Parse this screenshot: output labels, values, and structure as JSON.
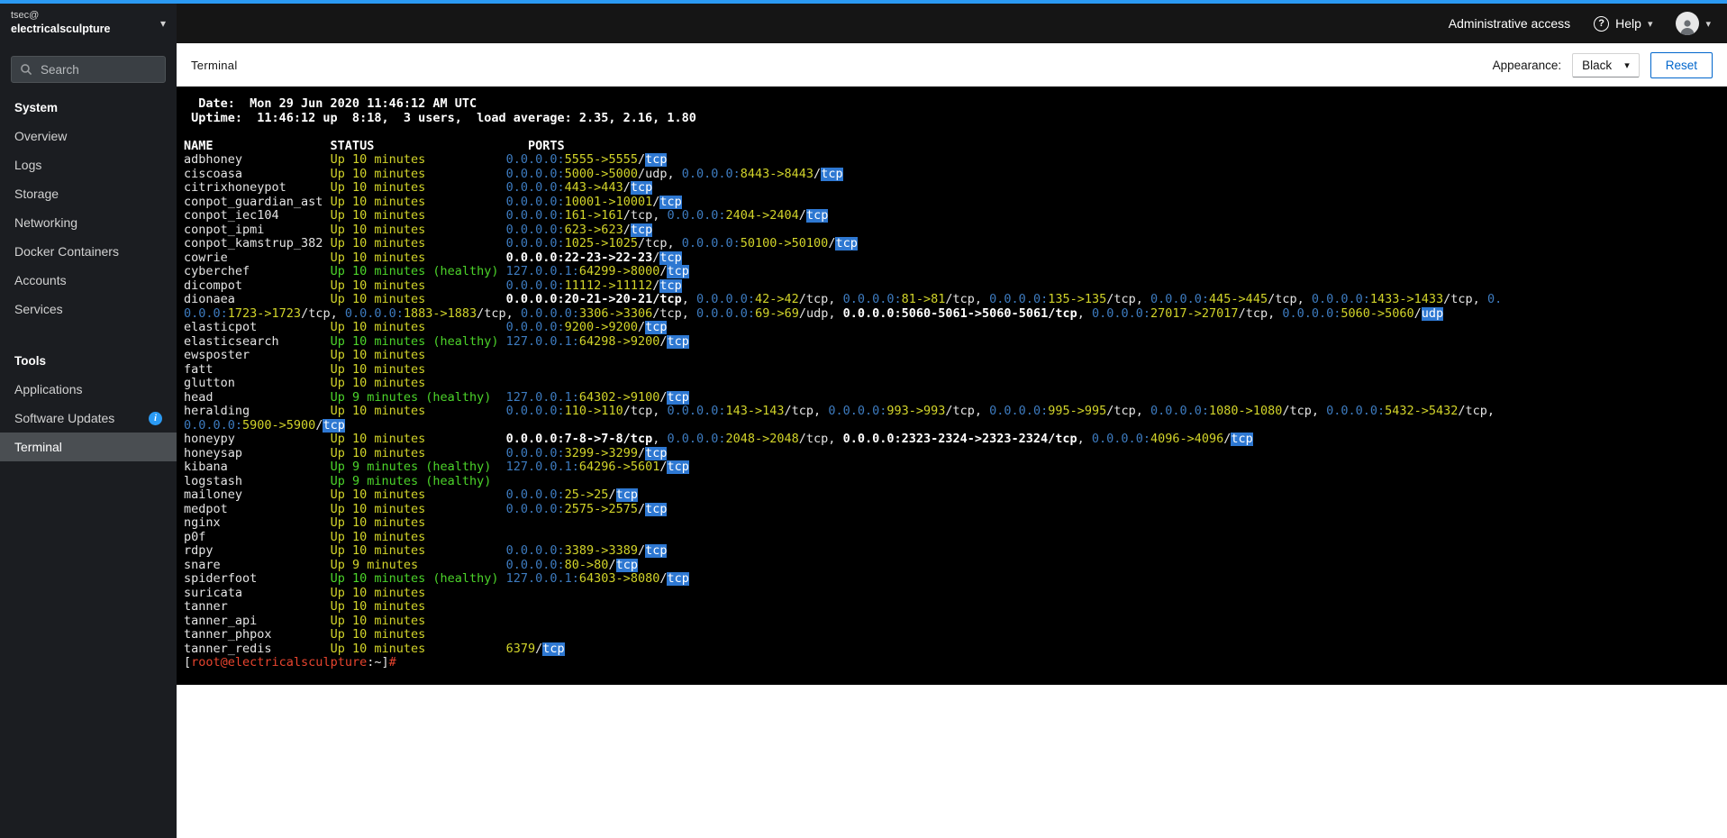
{
  "palette": {
    "accent_blue": "#2b9af3",
    "terminal_bg": "#000000",
    "term_fg": "#e4e4e4",
    "term_bold": "#ffffff",
    "term_yellow": "#d2d42a",
    "term_green": "#4cd42a",
    "term_blue": "#3d7bbf",
    "term_red": "#e8442e",
    "term_highlight_bg": "#2e78d2"
  },
  "icons": {
    "caret_down": "▾",
    "help": "?",
    "info": "i"
  },
  "masthead": {
    "host_user": "tsec@",
    "host_name": "electricalsculpture",
    "admin_access_label": "Administrative access",
    "help_label": "Help"
  },
  "sidebar": {
    "search_placeholder": "Search",
    "sections": [
      {
        "title": "System",
        "items": [
          {
            "label": "Overview"
          },
          {
            "label": "Logs"
          },
          {
            "label": "Storage"
          },
          {
            "label": "Networking"
          },
          {
            "label": "Docker Containers"
          },
          {
            "label": "Accounts"
          },
          {
            "label": "Services"
          }
        ]
      },
      {
        "title": "Tools",
        "items": [
          {
            "label": "Applications"
          },
          {
            "label": "Software Updates",
            "info": true
          },
          {
            "label": "Terminal",
            "selected": true
          }
        ]
      }
    ]
  },
  "content_header": {
    "title": "Terminal",
    "appearance_label": "Appearance:",
    "appearance_value": "Black",
    "reset_label": "Reset"
  },
  "terminal": {
    "lines": [
      [
        [
          "  Date:  Mon 29 Jun 2020 11:46:12 AM UTC",
          "b"
        ]
      ],
      [
        [
          " Uptime:  11:46:12 up  8:18,  3 users,  load average: 2.35, 2.16, 1.80",
          "b"
        ]
      ],
      [
        [
          " ",
          "w"
        ]
      ],
      [
        [
          "NAME                STATUS                     PORTS",
          "b"
        ]
      ],
      [
        [
          "adbhoney            ",
          "w"
        ],
        [
          "Up 10 minutes           ",
          "y"
        ],
        [
          "0.0.0.0:",
          "bl"
        ],
        [
          "5555->5555",
          "y"
        ],
        [
          "/",
          "w"
        ],
        [
          "tcp",
          "hl"
        ]
      ],
      [
        [
          "ciscoasa            ",
          "w"
        ],
        [
          "Up 10 minutes           ",
          "y"
        ],
        [
          "0.0.0.0:",
          "bl"
        ],
        [
          "5000->5000",
          "y"
        ],
        [
          "/udp, ",
          "w"
        ],
        [
          "0.0.0.0:",
          "bl"
        ],
        [
          "8443->8443",
          "y"
        ],
        [
          "/",
          "w"
        ],
        [
          "tcp",
          "hl"
        ]
      ],
      [
        [
          "citrixhoneypot      ",
          "w"
        ],
        [
          "Up 10 minutes           ",
          "y"
        ],
        [
          "0.0.0.0:",
          "bl"
        ],
        [
          "443->443",
          "y"
        ],
        [
          "/",
          "w"
        ],
        [
          "tcp",
          "hl"
        ]
      ],
      [
        [
          "conpot_guardian_ast ",
          "w"
        ],
        [
          "Up 10 minutes           ",
          "y"
        ],
        [
          "0.0.0.0:",
          "bl"
        ],
        [
          "10001->10001",
          "y"
        ],
        [
          "/",
          "w"
        ],
        [
          "tcp",
          "hl"
        ]
      ],
      [
        [
          "conpot_iec104       ",
          "w"
        ],
        [
          "Up 10 minutes           ",
          "y"
        ],
        [
          "0.0.0.0:",
          "bl"
        ],
        [
          "161->161",
          "y"
        ],
        [
          "/tcp, ",
          "w"
        ],
        [
          "0.0.0.0:",
          "bl"
        ],
        [
          "2404->2404",
          "y"
        ],
        [
          "/",
          "w"
        ],
        [
          "tcp",
          "hl"
        ]
      ],
      [
        [
          "conpot_ipmi         ",
          "w"
        ],
        [
          "Up 10 minutes           ",
          "y"
        ],
        [
          "0.0.0.0:",
          "bl"
        ],
        [
          "623->623",
          "y"
        ],
        [
          "/",
          "w"
        ],
        [
          "tcp",
          "hl"
        ]
      ],
      [
        [
          "conpot_kamstrup_382 ",
          "w"
        ],
        [
          "Up 10 minutes           ",
          "y"
        ],
        [
          "0.0.0.0:",
          "bl"
        ],
        [
          "1025->1025",
          "y"
        ],
        [
          "/tcp, ",
          "w"
        ],
        [
          "0.0.0.0:",
          "bl"
        ],
        [
          "50100->50100",
          "y"
        ],
        [
          "/",
          "w"
        ],
        [
          "tcp",
          "hl"
        ]
      ],
      [
        [
          "cowrie              ",
          "w"
        ],
        [
          "Up 10 minutes           ",
          "y"
        ],
        [
          "0.0.0.0:22-23->22-23",
          "b"
        ],
        [
          "/",
          "w"
        ],
        [
          "tcp",
          "hl"
        ]
      ],
      [
        [
          "cyberchef           ",
          "w"
        ],
        [
          "Up 10 minutes (healthy) ",
          "g"
        ],
        [
          "127.0.0.1:",
          "bl"
        ],
        [
          "64299->8000",
          "y"
        ],
        [
          "/",
          "w"
        ],
        [
          "tcp",
          "hl"
        ]
      ],
      [
        [
          "dicompot            ",
          "w"
        ],
        [
          "Up 10 minutes           ",
          "y"
        ],
        [
          "0.0.0.0:",
          "bl"
        ],
        [
          "11112->11112",
          "y"
        ],
        [
          "/",
          "w"
        ],
        [
          "tcp",
          "hl"
        ]
      ],
      [
        [
          "dionaea             ",
          "w"
        ],
        [
          "Up 10 minutes           ",
          "y"
        ],
        [
          "0.0.0.0:20-21->20-21/tcp",
          "b"
        ],
        [
          ", ",
          "w"
        ],
        [
          "0.0.0.0:",
          "bl"
        ],
        [
          "42->42",
          "y"
        ],
        [
          "/tcp, ",
          "w"
        ],
        [
          "0.0.0.0:",
          "bl"
        ],
        [
          "81->81",
          "y"
        ],
        [
          "/tcp, ",
          "w"
        ],
        [
          "0.0.0.0:",
          "bl"
        ],
        [
          "135->135",
          "y"
        ],
        [
          "/tcp, ",
          "w"
        ],
        [
          "0.0.0.0:",
          "bl"
        ],
        [
          "445->445",
          "y"
        ],
        [
          "/tcp, ",
          "w"
        ],
        [
          "0.0.0.0:",
          "bl"
        ],
        [
          "1433->1433",
          "y"
        ],
        [
          "/tcp, ",
          "w"
        ],
        [
          "0.",
          "bl"
        ]
      ],
      [
        [
          "0.0.0:",
          "bl"
        ],
        [
          "1723->1723",
          "y"
        ],
        [
          "/tcp, ",
          "w"
        ],
        [
          "0.0.0.0:",
          "bl"
        ],
        [
          "1883->1883",
          "y"
        ],
        [
          "/tcp, ",
          "w"
        ],
        [
          "0.0.0.0:",
          "bl"
        ],
        [
          "3306->3306",
          "y"
        ],
        [
          "/tcp, ",
          "w"
        ],
        [
          "0.0.0.0:",
          "bl"
        ],
        [
          "69->69",
          "y"
        ],
        [
          "/udp, ",
          "w"
        ],
        [
          "0.0.0.0:5060-5061->5060-5061/tcp",
          "b"
        ],
        [
          ", ",
          "w"
        ],
        [
          "0.0.0.0:",
          "bl"
        ],
        [
          "27017->27017",
          "y"
        ],
        [
          "/tcp, ",
          "w"
        ],
        [
          "0.0.0.0:",
          "bl"
        ],
        [
          "5060->5060",
          "y"
        ],
        [
          "/",
          "w"
        ],
        [
          "udp",
          "hl"
        ]
      ],
      [
        [
          "elasticpot          ",
          "w"
        ],
        [
          "Up 10 minutes           ",
          "y"
        ],
        [
          "0.0.0.0:",
          "bl"
        ],
        [
          "9200->9200",
          "y"
        ],
        [
          "/",
          "w"
        ],
        [
          "tcp",
          "hl"
        ]
      ],
      [
        [
          "elasticsearch       ",
          "w"
        ],
        [
          "Up 10 minutes (healthy) ",
          "g"
        ],
        [
          "127.0.0.1:",
          "bl"
        ],
        [
          "64298->9200",
          "y"
        ],
        [
          "/",
          "w"
        ],
        [
          "tcp",
          "hl"
        ]
      ],
      [
        [
          "ewsposter           ",
          "w"
        ],
        [
          "Up 10 minutes",
          "y"
        ]
      ],
      [
        [
          "fatt                ",
          "w"
        ],
        [
          "Up 10 minutes",
          "y"
        ]
      ],
      [
        [
          "glutton             ",
          "w"
        ],
        [
          "Up 10 minutes",
          "y"
        ]
      ],
      [
        [
          "head                ",
          "w"
        ],
        [
          "Up 9 minutes (healthy)  ",
          "g"
        ],
        [
          "127.0.0.1:",
          "bl"
        ],
        [
          "64302->9100",
          "y"
        ],
        [
          "/",
          "w"
        ],
        [
          "tcp",
          "hl"
        ]
      ],
      [
        [
          "heralding           ",
          "w"
        ],
        [
          "Up 10 minutes           ",
          "y"
        ],
        [
          "0.0.0.0:",
          "bl"
        ],
        [
          "110->110",
          "y"
        ],
        [
          "/tcp, ",
          "w"
        ],
        [
          "0.0.0.0:",
          "bl"
        ],
        [
          "143->143",
          "y"
        ],
        [
          "/tcp, ",
          "w"
        ],
        [
          "0.0.0.0:",
          "bl"
        ],
        [
          "993->993",
          "y"
        ],
        [
          "/tcp, ",
          "w"
        ],
        [
          "0.0.0.0:",
          "bl"
        ],
        [
          "995->995",
          "y"
        ],
        [
          "/tcp, ",
          "w"
        ],
        [
          "0.0.0.0:",
          "bl"
        ],
        [
          "1080->1080",
          "y"
        ],
        [
          "/tcp, ",
          "w"
        ],
        [
          "0.0.0.0:",
          "bl"
        ],
        [
          "5432->5432",
          "y"
        ],
        [
          "/tcp,",
          "w"
        ]
      ],
      [
        [
          "0.0.0.0:",
          "bl"
        ],
        [
          "5900->5900",
          "y"
        ],
        [
          "/",
          "w"
        ],
        [
          "tcp",
          "hl"
        ]
      ],
      [
        [
          "honeypy             ",
          "w"
        ],
        [
          "Up 10 minutes           ",
          "y"
        ],
        [
          "0.0.0.0:7-8->7-8/tcp",
          "b"
        ],
        [
          ", ",
          "w"
        ],
        [
          "0.0.0.0:",
          "bl"
        ],
        [
          "2048->2048",
          "y"
        ],
        [
          "/tcp, ",
          "w"
        ],
        [
          "0.0.0.0:2323-2324->2323-2324/tcp",
          "b"
        ],
        [
          ", ",
          "w"
        ],
        [
          "0.0.0.0:",
          "bl"
        ],
        [
          "4096->4096",
          "y"
        ],
        [
          "/",
          "w"
        ],
        [
          "tcp",
          "hl"
        ]
      ],
      [
        [
          "honeysap            ",
          "w"
        ],
        [
          "Up 10 minutes           ",
          "y"
        ],
        [
          "0.0.0.0:",
          "bl"
        ],
        [
          "3299->3299",
          "y"
        ],
        [
          "/",
          "w"
        ],
        [
          "tcp",
          "hl"
        ]
      ],
      [
        [
          "kibana              ",
          "w"
        ],
        [
          "Up 9 minutes (healthy)  ",
          "g"
        ],
        [
          "127.0.0.1:",
          "bl"
        ],
        [
          "64296->5601",
          "y"
        ],
        [
          "/",
          "w"
        ],
        [
          "tcp",
          "hl"
        ]
      ],
      [
        [
          "logstash            ",
          "w"
        ],
        [
          "Up 9 minutes (healthy)",
          "g"
        ]
      ],
      [
        [
          "mailoney            ",
          "w"
        ],
        [
          "Up 10 minutes           ",
          "y"
        ],
        [
          "0.0.0.0:",
          "bl"
        ],
        [
          "25->25",
          "y"
        ],
        [
          "/",
          "w"
        ],
        [
          "tcp",
          "hl"
        ]
      ],
      [
        [
          "medpot              ",
          "w"
        ],
        [
          "Up 10 minutes           ",
          "y"
        ],
        [
          "0.0.0.0:",
          "bl"
        ],
        [
          "2575->2575",
          "y"
        ],
        [
          "/",
          "w"
        ],
        [
          "tcp",
          "hl"
        ]
      ],
      [
        [
          "nginx               ",
          "w"
        ],
        [
          "Up 10 minutes",
          "y"
        ]
      ],
      [
        [
          "p0f                 ",
          "w"
        ],
        [
          "Up 10 minutes",
          "y"
        ]
      ],
      [
        [
          "rdpy                ",
          "w"
        ],
        [
          "Up 10 minutes           ",
          "y"
        ],
        [
          "0.0.0.0:",
          "bl"
        ],
        [
          "3389->3389",
          "y"
        ],
        [
          "/",
          "w"
        ],
        [
          "tcp",
          "hl"
        ]
      ],
      [
        [
          "snare               ",
          "w"
        ],
        [
          "Up 9 minutes            ",
          "y"
        ],
        [
          "0.0.0.0:",
          "bl"
        ],
        [
          "80->80",
          "y"
        ],
        [
          "/",
          "w"
        ],
        [
          "tcp",
          "hl"
        ]
      ],
      [
        [
          "spiderfoot          ",
          "w"
        ],
        [
          "Up 10 minutes (healthy) ",
          "g"
        ],
        [
          "127.0.0.1:",
          "bl"
        ],
        [
          "64303->8080",
          "y"
        ],
        [
          "/",
          "w"
        ],
        [
          "tcp",
          "hl"
        ]
      ],
      [
        [
          "suricata            ",
          "w"
        ],
        [
          "Up 10 minutes",
          "y"
        ]
      ],
      [
        [
          "tanner              ",
          "w"
        ],
        [
          "Up 10 minutes",
          "y"
        ]
      ],
      [
        [
          "tanner_api          ",
          "w"
        ],
        [
          "Up 10 minutes",
          "y"
        ]
      ],
      [
        [
          "tanner_phpox        ",
          "w"
        ],
        [
          "Up 10 minutes",
          "y"
        ]
      ],
      [
        [
          "tanner_redis        ",
          "w"
        ],
        [
          "Up 10 minutes           ",
          "y"
        ],
        [
          "6379",
          "y"
        ],
        [
          "/",
          "w"
        ],
        [
          "tcp",
          "hl"
        ]
      ],
      [
        [
          "[",
          "w"
        ],
        [
          "root@electricalsculpture",
          "r"
        ],
        [
          ":~]",
          "w"
        ],
        [
          "#",
          "r"
        ],
        [
          " ",
          "w"
        ]
      ]
    ]
  }
}
